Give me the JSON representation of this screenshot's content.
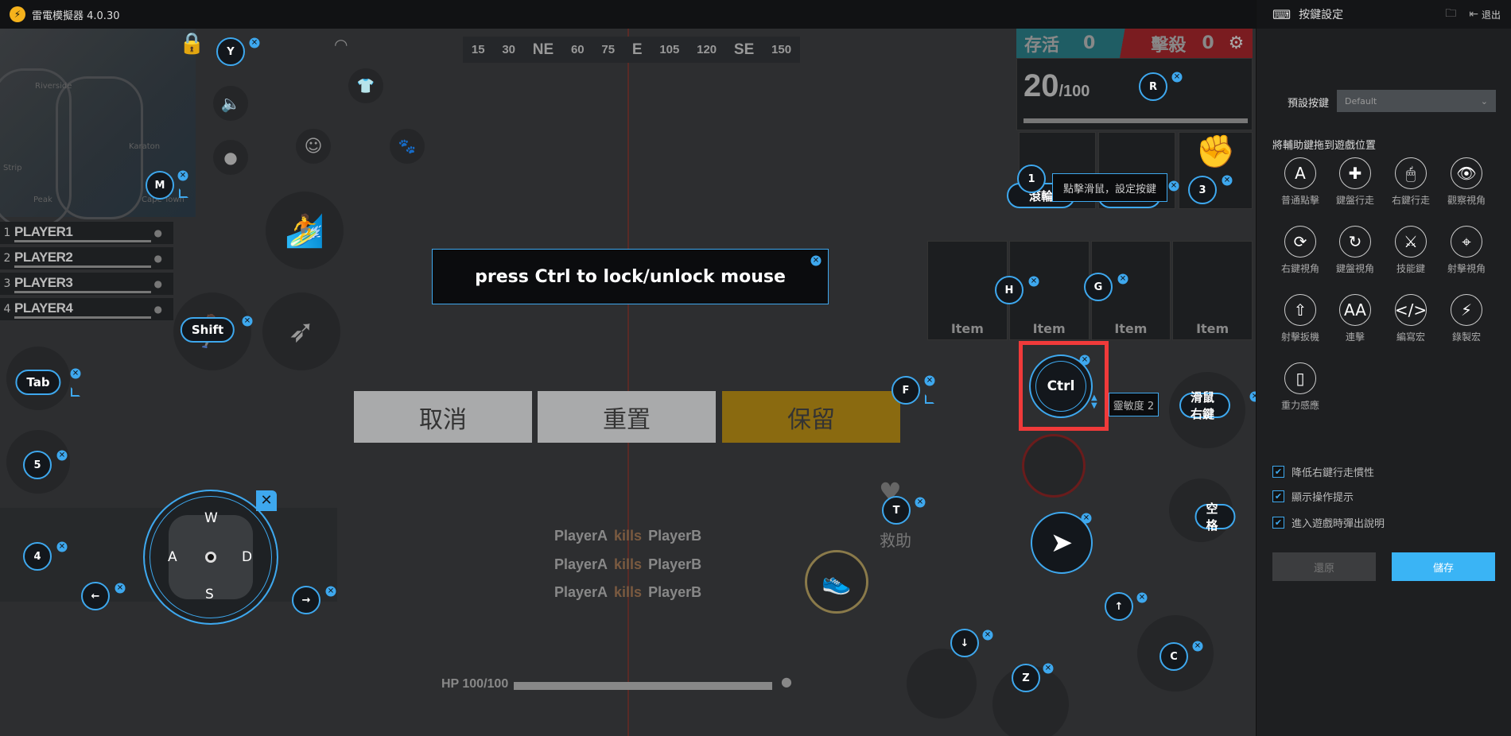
{
  "window": {
    "title": "雷電模擬器 4.0.30"
  },
  "minimap": {
    "labels": [
      "Riverside",
      "Karaton",
      "Strip",
      "Peak",
      "Cape Town"
    ]
  },
  "players": [
    {
      "num": "1",
      "name": "PLAYER1"
    },
    {
      "num": "2",
      "name": "PLAYER2"
    },
    {
      "num": "3",
      "name": "PLAYER3"
    },
    {
      "num": "4",
      "name": "PLAYER4"
    }
  ],
  "compass": [
    "15",
    "30",
    "NE",
    "60",
    "75",
    "E",
    "105",
    "120",
    "SE",
    "150"
  ],
  "score": {
    "alive_label": "存活",
    "alive": "0",
    "kills_label": "擊殺",
    "kills": "0"
  },
  "ammo": {
    "current": "20",
    "max": "/100"
  },
  "items": [
    "Item",
    "Item",
    "Item",
    "Item"
  ],
  "message": "press Ctrl to lock/unlock mouse",
  "buttons": {
    "cancel": "取消",
    "reset": "重置",
    "keep": "保留"
  },
  "killfeed": [
    {
      "a": "PlayerA",
      "v": "kills",
      "b": "PlayerB"
    },
    {
      "a": "PlayerA",
      "v": "kills",
      "b": "PlayerB"
    },
    {
      "a": "PlayerA",
      "v": "kills",
      "b": "PlayerB"
    }
  ],
  "hp": {
    "label": "HP 100/100",
    "value": 100
  },
  "rescue": "救助",
  "keys": {
    "Y": "Y",
    "M": "M",
    "Shift": "Shift",
    "Tab": "Tab",
    "k5": "5",
    "k4": "4",
    "left": "←",
    "right": "→",
    "W": "W",
    "A": "A",
    "S": "S",
    "D": "D",
    "T": "T",
    "F": "F",
    "H": "H",
    "G": "G",
    "R": "R",
    "k1": "1",
    "wheel": "滾輪",
    "k3": "3",
    "rmb": "滑鼠右鍵",
    "space": "空格",
    "up": "↑",
    "down": "↓",
    "Z": "Z",
    "C": "C",
    "Ctrl": "Ctrl"
  },
  "tooltip": "點擊滑鼠，設定按鍵",
  "sensitivity": "靈敏度 2",
  "accent": "#3ea8ee",
  "highlight": "#f03a3a",
  "side": {
    "title": "按鍵設定",
    "exit": "退出",
    "preset_label": "預設按鍵",
    "preset_value": "Default",
    "drag_hint": "將輔助鍵拖到遊戲位置",
    "tools": [
      {
        "icon": "A",
        "label": "普通點擊"
      },
      {
        "icon": "✚",
        "label": "鍵盤行走"
      },
      {
        "icon": "🖱",
        "label": "右鍵行走"
      },
      {
        "icon": "👁",
        "label": "觀察視角"
      },
      {
        "icon": "⟳",
        "label": "右鍵視角"
      },
      {
        "icon": "↻",
        "label": "鍵盤視角"
      },
      {
        "icon": "⚔",
        "label": "技能鍵"
      },
      {
        "icon": "⌖",
        "label": "射擊視角"
      },
      {
        "icon": "⇧",
        "label": "射擊扳機"
      },
      {
        "icon": "AA",
        "label": "連擊"
      },
      {
        "icon": "</>",
        "label": "編寫宏"
      },
      {
        "icon": "⚡",
        "label": "錄製宏"
      },
      {
        "icon": "▯",
        "label": "重力感應"
      }
    ],
    "options": [
      {
        "label": "降低右鍵行走慣性",
        "checked": true
      },
      {
        "label": "顯示操作提示",
        "checked": true
      },
      {
        "label": "進入遊戲時彈出說明",
        "checked": true
      }
    ],
    "restore": "還原",
    "save": "儲存"
  }
}
